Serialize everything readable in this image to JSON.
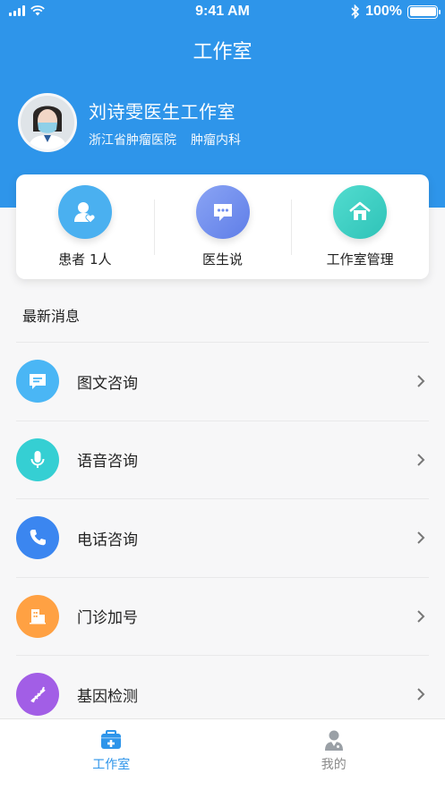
{
  "status_bar": {
    "time": "9:41 AM",
    "battery": "100%"
  },
  "nav": {
    "title": "工作室"
  },
  "profile": {
    "name": "刘诗雯医生工作室",
    "hospital": "浙江省肿瘤医院",
    "department": "肿瘤内科"
  },
  "quick_actions": [
    {
      "label": "患者  1人",
      "icon": "patients-icon",
      "color": "#4ab0f0"
    },
    {
      "label": "医生说",
      "icon": "chat-icon",
      "color": "#6f8ef0"
    },
    {
      "label": "工作室管理",
      "icon": "home-icon",
      "color": "#3ed1c4"
    }
  ],
  "section": {
    "title": "最新消息"
  },
  "list": [
    {
      "label": "图文咨询",
      "icon": "message-icon",
      "color": "#4ab6f5"
    },
    {
      "label": "语音咨询",
      "icon": "microphone-icon",
      "color": "#35cfd3"
    },
    {
      "label": "电话咨询",
      "icon": "phone-icon",
      "color": "#3b86f0"
    },
    {
      "label": "门诊加号",
      "icon": "clinic-icon",
      "color": "#ffa143"
    },
    {
      "label": "基因检测",
      "icon": "dna-icon",
      "color": "#a25ee6"
    }
  ],
  "tabbar": {
    "tabs": [
      {
        "label": "工作室",
        "icon": "medical-kit-icon",
        "active": true
      },
      {
        "label": "我的",
        "icon": "doctor-icon",
        "active": false
      }
    ]
  },
  "colors": {
    "primary": "#2e95ea",
    "background": "#f7f7f8"
  }
}
